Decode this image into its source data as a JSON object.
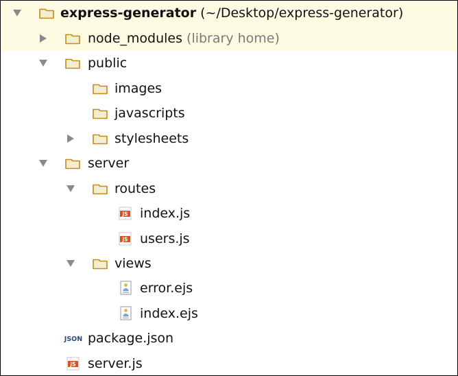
{
  "colors": {
    "folder_fill": "#f2eed0",
    "folder_stroke": "#c48a1c",
    "selected_row": "#fdfbe1",
    "js_badge": "#d9531e",
    "json_badge": "#2a4a8a",
    "arrow": "#8a8a8a"
  },
  "tree": [
    {
      "label": "express-generator",
      "suffix": "(~/Desktop/express-generator)",
      "type": "folder",
      "icon": "folder-icon",
      "expanded": true
    },
    {
      "label": "node_modules",
      "suffix": "(library home)",
      "type": "folder",
      "icon": "folder-icon",
      "expanded": false
    },
    {
      "label": "public",
      "type": "folder",
      "icon": "folder-icon",
      "expanded": true
    },
    {
      "label": "images",
      "type": "folder",
      "icon": "folder-icon"
    },
    {
      "label": "javascripts",
      "type": "folder",
      "icon": "folder-icon"
    },
    {
      "label": "stylesheets",
      "type": "folder",
      "icon": "folder-icon",
      "expanded": false
    },
    {
      "label": "server",
      "type": "folder",
      "icon": "folder-icon",
      "expanded": true
    },
    {
      "label": "routes",
      "type": "folder",
      "icon": "folder-icon",
      "expanded": true
    },
    {
      "label": "index.js",
      "type": "file",
      "icon": "js-file-icon",
      "badge": "JS"
    },
    {
      "label": "users.js",
      "type": "file",
      "icon": "js-file-icon",
      "badge": "JS"
    },
    {
      "label": "views",
      "type": "folder",
      "icon": "folder-icon",
      "expanded": true
    },
    {
      "label": "error.ejs",
      "type": "file",
      "icon": "ejs-file-icon"
    },
    {
      "label": "index.ejs",
      "type": "file",
      "icon": "ejs-file-icon"
    },
    {
      "label": "package.json",
      "type": "file",
      "icon": "json-file-icon",
      "badge": "JSON"
    },
    {
      "label": "server.js",
      "type": "file",
      "icon": "js-file-icon",
      "badge": "JS"
    }
  ]
}
